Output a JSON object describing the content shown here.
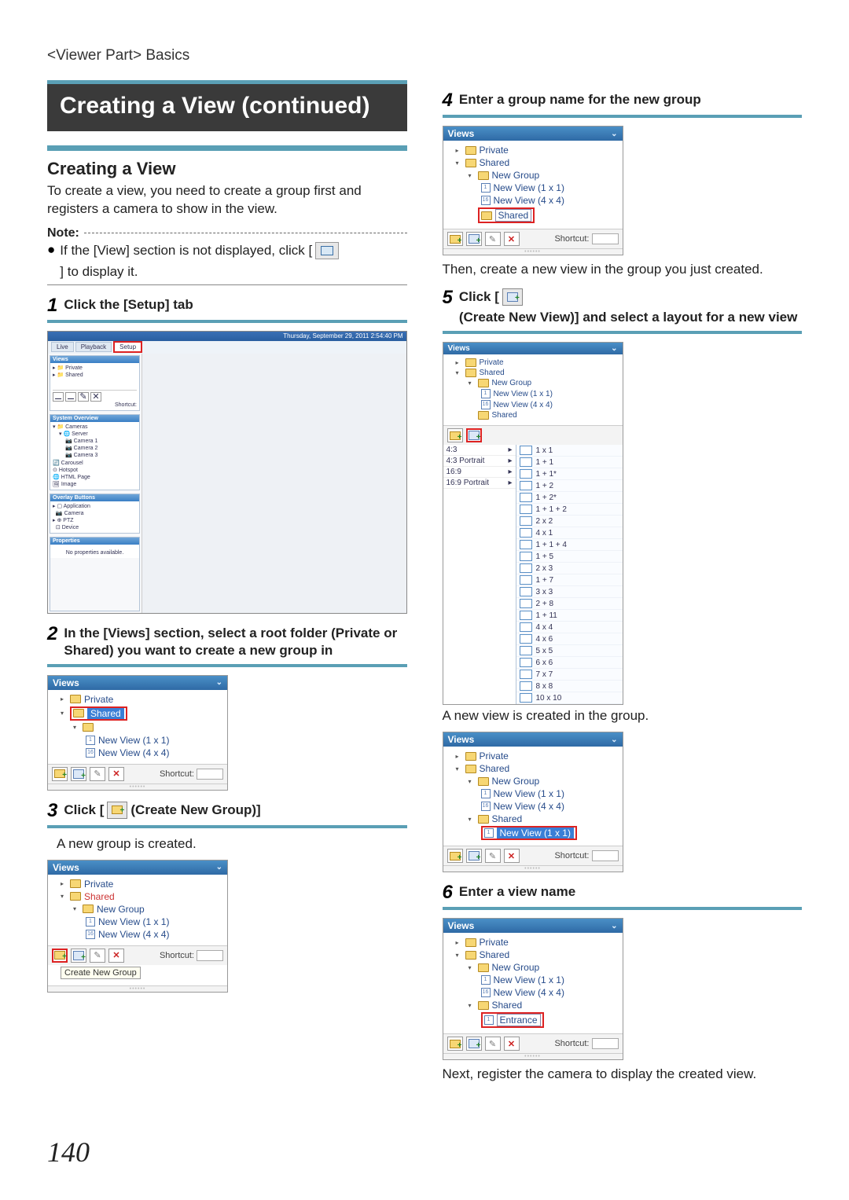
{
  "breadcrumb": "<Viewer Part> Basics",
  "titleBlock": "Creating a View (continued)",
  "section": {
    "heading": "Creating a View",
    "intro": "To create a view, you need to create a group first and registers a camera to show in the view.",
    "noteLabel": "Note:",
    "noteA": "If the [View] section is not displayed, click [",
    "noteB": "] to display it."
  },
  "steps": {
    "s1": {
      "num": "1",
      "text": "Click the [Setup] tab"
    },
    "s2": {
      "num": "2",
      "text": "In the [Views] section, select a root folder (Private or Shared) you want to create a new group in"
    },
    "s3": {
      "num": "3",
      "textA": "Click [",
      "textB": "(Create New Group)]",
      "after": "A new group is created."
    },
    "s4": {
      "num": "4",
      "text": "Enter a group name for the new group",
      "after": "Then, create a new view in the group you just created."
    },
    "s5": {
      "num": "5",
      "textA": "Click [",
      "textB": "(Create New View)] and select a layout for a new view",
      "after": "A new view is created in the group."
    },
    "s6": {
      "num": "6",
      "text": "Enter a view name",
      "after": "Next, register the camera to display the created view."
    }
  },
  "viewsPanel": {
    "header": "Views",
    "private": "Private",
    "shared": "Shared",
    "newGroup": "New Group",
    "nv11": "New View (1 x 1)",
    "nv44": "New View (4 x 4)",
    "shortcut": "Shortcut:",
    "tooltip": "Create New Group",
    "editName": "Shared",
    "entrance": "Entrance"
  },
  "setupShot": {
    "tabs": {
      "live": "Live",
      "playback": "Playback",
      "setup": "Setup"
    },
    "sidePanels": {
      "viewsHead": "Views",
      "private": "Private",
      "shared": "Shared",
      "sysHead": "System Overview",
      "cameras": "Cameras",
      "server": "Server",
      "cam1": "Camera 1",
      "cam2": "Camera 2",
      "cam3": "Camera 3",
      "carousel": "Carousel",
      "hotspot": "Hotspot",
      "html": "HTML Page",
      "image": "Image",
      "methodHead": "Overlay Buttons",
      "app": "Application",
      "camera": "Camera",
      "ptz": "PTZ",
      "device": "Device",
      "propHead": "Properties",
      "propBody": "No properties available."
    },
    "dateRight": "Thursday, September 29, 2011   2:54:40 PM"
  },
  "layoutPicker": {
    "aspects": {
      "a": "4:3",
      "b": "4:3 Portrait",
      "c": "16:9",
      "d": "16:9 Portrait"
    },
    "layouts": {
      "l1": "1 x 1",
      "l2": "1 + 1",
      "l3": "1 + 1*",
      "l4": "1 + 2",
      "l5": "1 + 2*",
      "l6": "1 + 1 + 2",
      "l7": "2 x 2",
      "l8": "4 x 1",
      "l9": "1 + 1 + 4",
      "l10": "1 + 5",
      "l11": "2 x 3",
      "l12": "1 + 7",
      "l13": "3 x 3",
      "l14": "2 + 8",
      "l15": "1 + 11",
      "l16": "4 x 4",
      "l17": "4 x 6",
      "l18": "5 x 5",
      "l19": "6 x 6",
      "l20": "7 x 7",
      "l21": "8 x 8",
      "l22": "10 x 10"
    }
  },
  "pageNumber": "140"
}
